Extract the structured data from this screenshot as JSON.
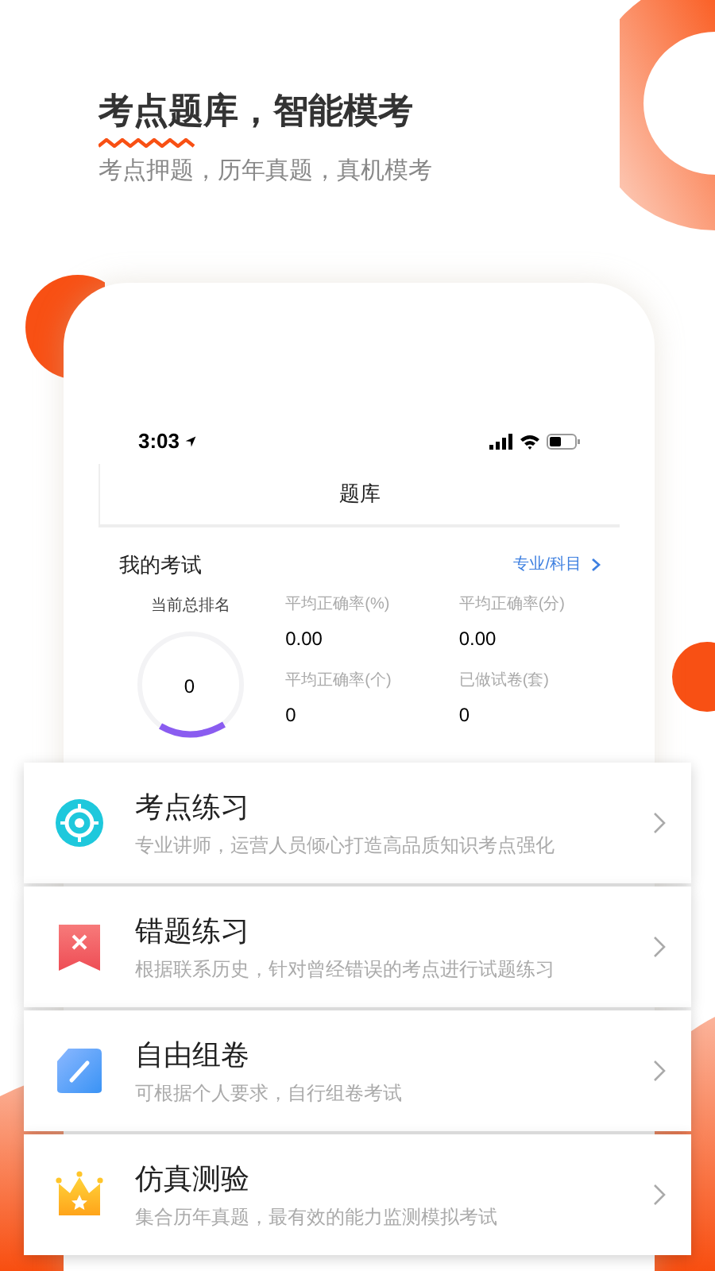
{
  "headline": "考点题库，智能模考",
  "subheadline": "考点押题，历年真题，真机模考",
  "phone": {
    "status_bar": {
      "time": "3:03"
    },
    "nav_title": "题库",
    "section_title": "我的考试",
    "section_link": "专业/科目",
    "rank": {
      "label": "当前总排名",
      "value": "0"
    },
    "stats": [
      {
        "label": "平均正确率(%)",
        "value": "0.00"
      },
      {
        "label": "平均正确率(分)",
        "value": "0.00"
      },
      {
        "label": "平均正确率(个)",
        "value": "0"
      },
      {
        "label": "已做试卷(套)",
        "value": "0"
      }
    ]
  },
  "features": [
    {
      "kind": "target",
      "title": "考点练习",
      "description": "专业讲师，运营人员倾心打造高品质知识考点强化"
    },
    {
      "kind": "bookmark",
      "title": "错题练习",
      "description": "根据联系历史，针对曾经错误的考点进行试题练习"
    },
    {
      "kind": "pencil",
      "title": "自由组卷",
      "description": "可根据个人要求，自行组卷考试"
    },
    {
      "kind": "crown",
      "title": "仿真测验",
      "description": "集合历年真题，最有效的能力监测模拟考试"
    }
  ]
}
